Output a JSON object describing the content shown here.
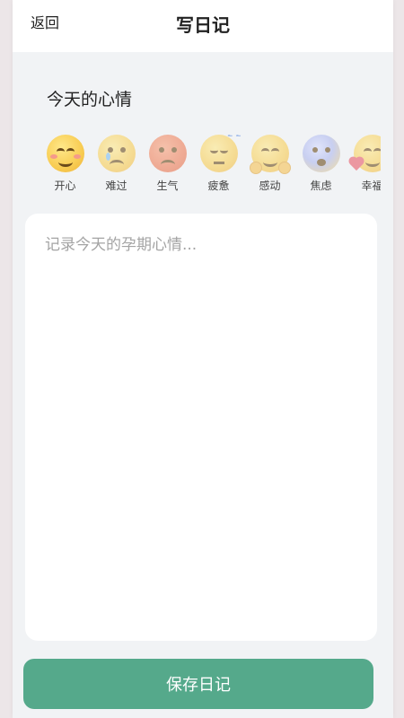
{
  "header": {
    "back_label": "返回",
    "title": "写日记"
  },
  "mood": {
    "heading": "今天的心情",
    "items": [
      {
        "label": "开心",
        "icon": "happy-face-icon"
      },
      {
        "label": "难过",
        "icon": "crying-face-icon"
      },
      {
        "label": "生气",
        "icon": "angry-face-icon"
      },
      {
        "label": "疲惫",
        "icon": "sleepy-face-icon"
      },
      {
        "label": "感动",
        "icon": "hugging-face-icon"
      },
      {
        "label": "焦虑",
        "icon": "anxious-face-icon"
      },
      {
        "label": "幸福",
        "icon": "smiling-hearts-face-icon"
      }
    ]
  },
  "diary": {
    "placeholder": "记录今天的孕期心情...",
    "value": ""
  },
  "actions": {
    "save_label": "保存日记"
  },
  "colors": {
    "accent": "#55a98b",
    "background": "#f1f3f5"
  }
}
